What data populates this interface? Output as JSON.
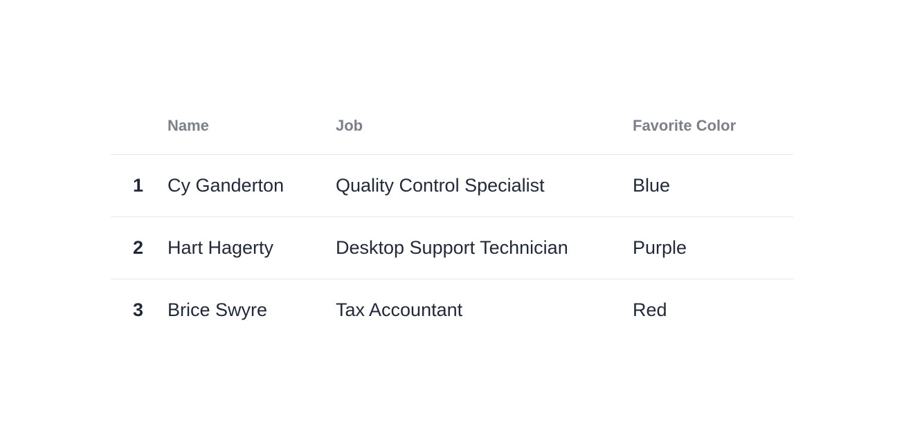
{
  "table": {
    "headers": {
      "index": "",
      "name": "Name",
      "job": "Job",
      "color": "Favorite Color"
    },
    "rows": [
      {
        "index": "1",
        "name": "Cy Ganderton",
        "job": "Quality Control Specialist",
        "color": "Blue"
      },
      {
        "index": "2",
        "name": "Hart Hagerty",
        "job": "Desktop Support Technician",
        "color": "Purple"
      },
      {
        "index": "3",
        "name": "Brice Swyre",
        "job": "Tax Accountant",
        "color": "Red"
      }
    ]
  }
}
